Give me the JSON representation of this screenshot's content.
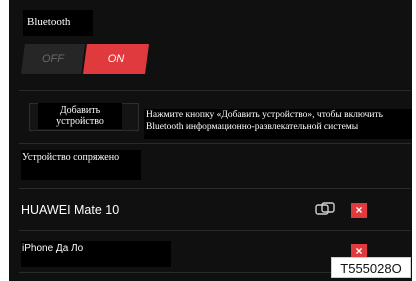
{
  "bluetooth": {
    "title": "Bluetooth",
    "toggle_off": "OFF",
    "toggle_on": "ON"
  },
  "add_device": {
    "button_label": "Добавить устройство",
    "hint_line1": "Нажмите кнопку «Добавить устройство», чтобы включить",
    "hint_line2": "Bluetooth информационно-развлекательной системы"
  },
  "paired": {
    "heading": "Устройство сопряжено",
    "devices": [
      {
        "name": "HUAWEI Mate 10",
        "icon": "link-icon",
        "delete": "×"
      },
      {
        "name": "iPhone Да Ло",
        "delete": "×"
      }
    ]
  },
  "figure_code": "T555028O",
  "colors": {
    "accent": "#e03a3e",
    "background": "#101010"
  }
}
